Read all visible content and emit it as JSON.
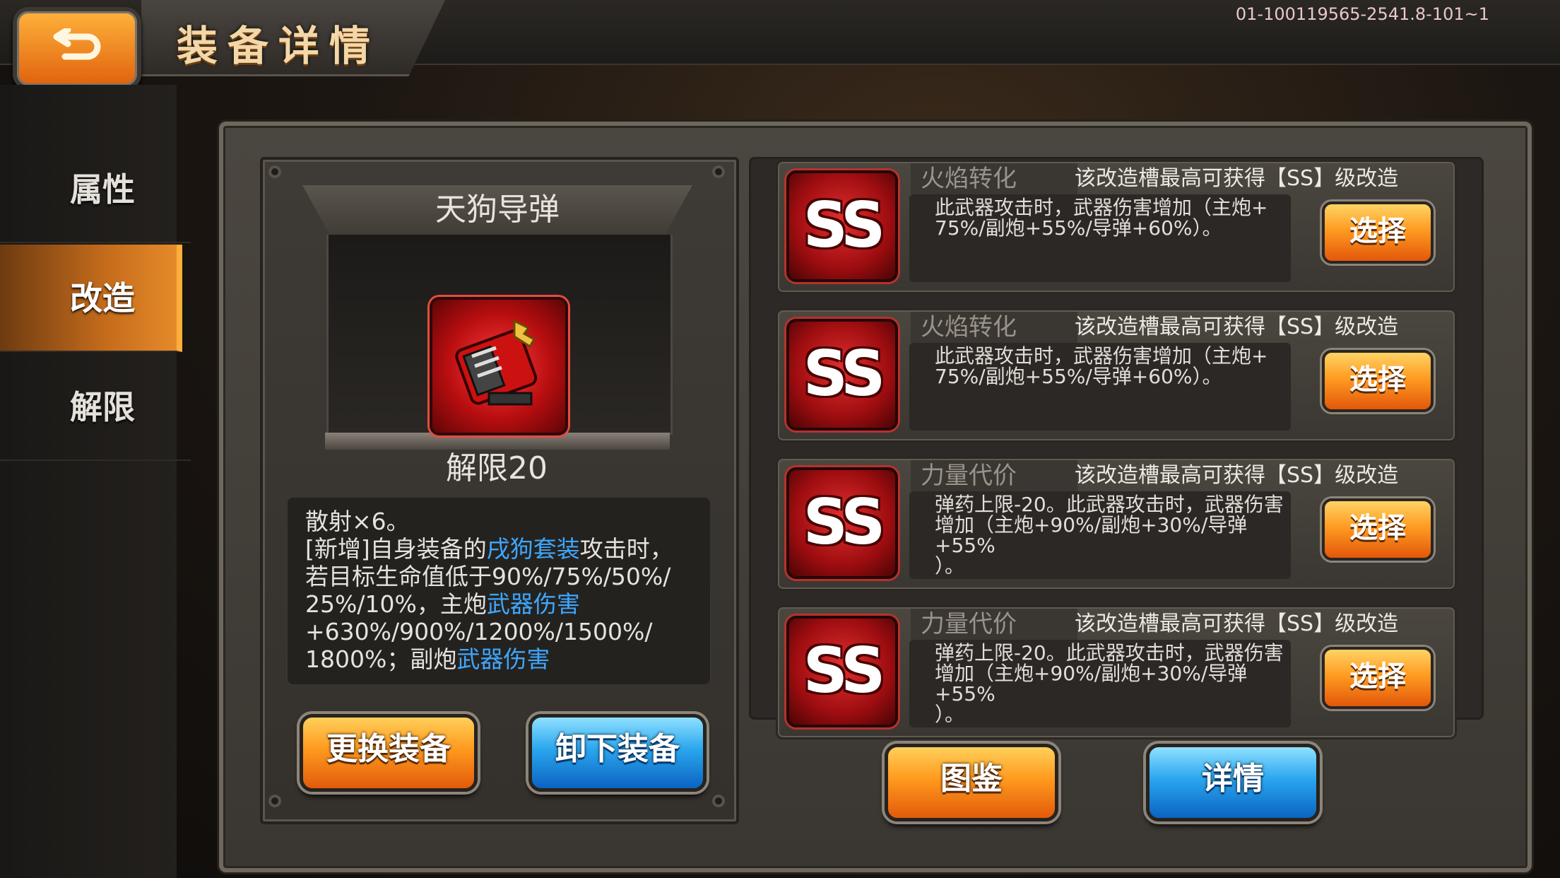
{
  "header": {
    "title": "装备详情",
    "session_id": "01-100119565-2541.8-101~1"
  },
  "sidebar": {
    "tabs": [
      {
        "label": "属性",
        "active": false
      },
      {
        "label": "改造",
        "active": true
      },
      {
        "label": "解限",
        "active": false
      }
    ]
  },
  "equipment": {
    "name": "天狗导弹",
    "limit_label": "解限20",
    "icon": "missile-launcher-icon",
    "description": {
      "line1": "散射×6。",
      "line2_a": "[新增]自身装备的",
      "line2_hl": "戌狗套装",
      "line2_b": "攻击时，",
      "line3": "若目标生命值低于90%/75%/50%/",
      "line4_a": "25%/10%，主炮",
      "line4_hl": "武器伤害",
      "line5": "+630%/900%/1200%/1500%/",
      "line6_a": "1800%；副炮",
      "line6_hl": "武器伤害"
    },
    "replace_button": "更换装备",
    "unequip_button": "卸下装备"
  },
  "slots": [
    {
      "grade": "SS",
      "name": "火焰转化",
      "hint": "该改造槽最高可获得【SS】级改造",
      "desc_line1": "此武器攻击时，武器伤害增加（主炮+",
      "desc_line2": "75%/副炮+55%/导弹+60%）。",
      "desc_line3": "",
      "select_label": "选择"
    },
    {
      "grade": "SS",
      "name": "火焰转化",
      "hint": "该改造槽最高可获得【SS】级改造",
      "desc_line1": "此武器攻击时，武器伤害增加（主炮+",
      "desc_line2": "75%/副炮+55%/导弹+60%）。",
      "desc_line3": "",
      "select_label": "选择"
    },
    {
      "grade": "SS",
      "name": "力量代价",
      "hint": "该改造槽最高可获得【SS】级改造",
      "desc_line1": "弹药上限-20。此武器攻击时，武器伤害",
      "desc_line2": "增加（主炮+90%/副炮+30%/导弹+55%",
      "desc_line3": "）。",
      "select_label": "选择"
    },
    {
      "grade": "SS",
      "name": "力量代价",
      "hint": "该改造槽最高可获得【SS】级改造",
      "desc_line1": "弹药上限-20。此武器攻击时，武器伤害",
      "desc_line2": "增加（主炮+90%/副炮+30%/导弹+55%",
      "desc_line3": "）。",
      "select_label": "选择"
    }
  ],
  "footer": {
    "catalog_button": "图鉴",
    "details_button": "详情"
  },
  "colors": {
    "accent_orange": "#ff9a1e",
    "accent_blue": "#2aa6ee",
    "highlight_text": "#3ea7ff",
    "ss_red": "#b90e10"
  }
}
